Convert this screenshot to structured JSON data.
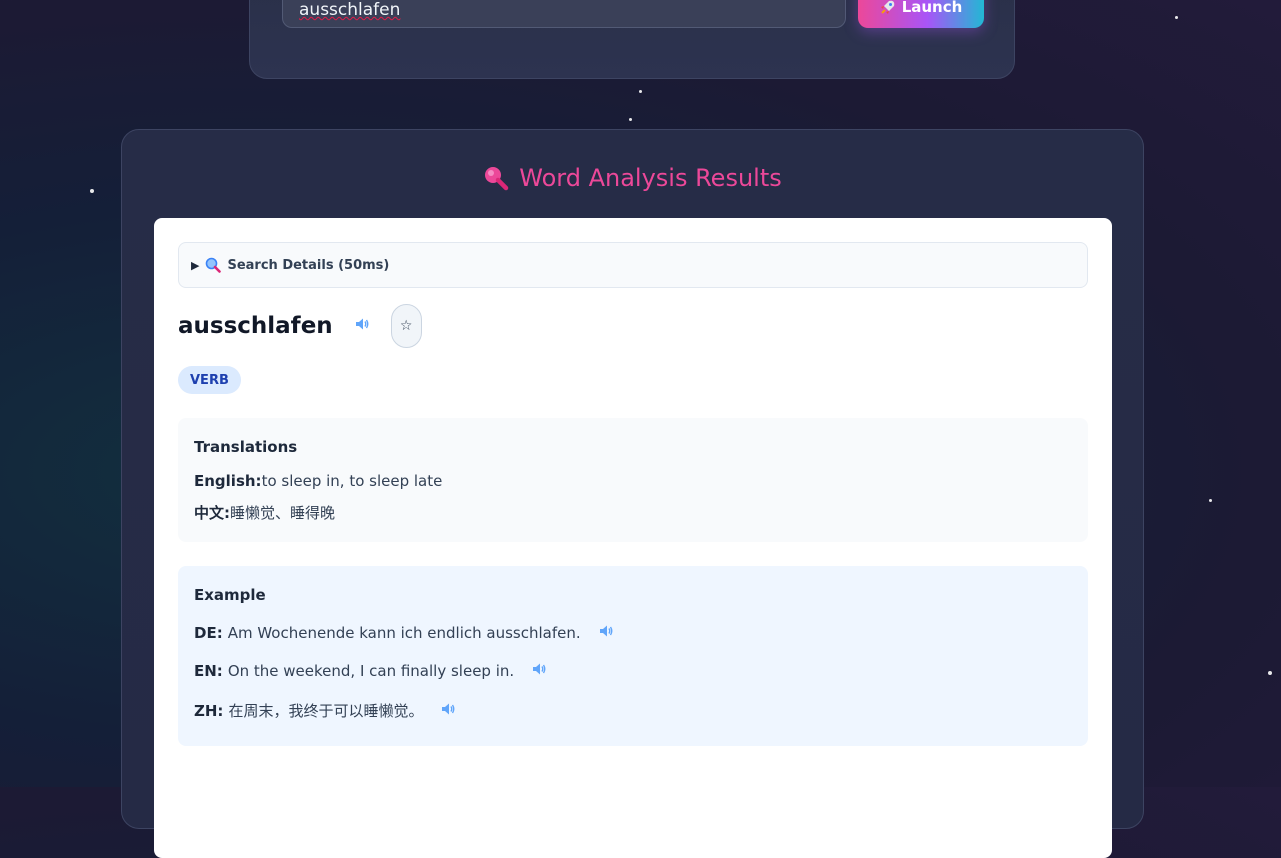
{
  "search": {
    "value": "ausschlafen",
    "launch_label": "Launch",
    "launch_icon": "rocket-icon"
  },
  "results": {
    "title": "Word Analysis Results",
    "title_icon": "magnifier-icon",
    "details_label": "Search Details (50ms)",
    "word": "ausschlafen",
    "favorite_glyph": "☆",
    "part_of_speech": "VERB",
    "translations": {
      "title": "Translations",
      "english_label": "English:",
      "english_value": "to sleep in, to sleep late",
      "chinese_label": "中文:",
      "chinese_value": "睡懒觉、睡得晚"
    },
    "example": {
      "title": "Example",
      "de_label": "DE:",
      "de_text": "Am Wochenende kann ich endlich ausschlafen.",
      "en_label": "EN:",
      "en_text": "On the weekend, I can finally sleep in.",
      "zh_label": "ZH:",
      "zh_text": "在周末，我终于可以睡懒觉。"
    }
  },
  "colors": {
    "accent": "#ec4899",
    "speaker": "#60a5fa",
    "badge_bg": "#dbeafe",
    "badge_text": "#1e40af"
  }
}
